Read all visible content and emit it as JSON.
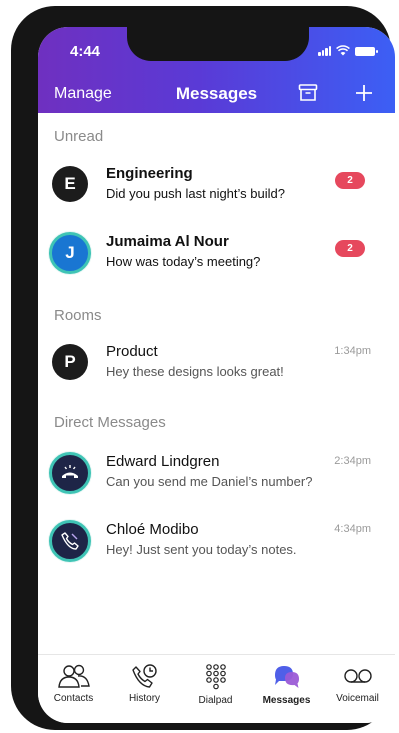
{
  "status_bar": {
    "time": "4:44"
  },
  "header": {
    "left_label": "Manage",
    "title": "Messages"
  },
  "sections": {
    "unread": "Unread",
    "rooms": "Rooms",
    "direct": "Direct Messages"
  },
  "unread": [
    {
      "initial": "E",
      "name": "Engineering",
      "preview": "Did you push last night’s build?",
      "badge": "2"
    },
    {
      "initial": "J",
      "name": "Jumaima Al Nour",
      "preview": "How was today’s meeting?",
      "badge": "2"
    }
  ],
  "rooms": [
    {
      "initial": "P",
      "name": "Product",
      "preview": "Hey these designs looks great!",
      "time": "1:34pm"
    }
  ],
  "direct": [
    {
      "name": "Edward Lindgren",
      "preview": "Can you send me Daniel’s number?",
      "time": "2:34pm"
    },
    {
      "name": "Chloé Modibo",
      "preview": "Hey! Just sent you today’s notes.",
      "time": "4:34pm"
    }
  ],
  "tabs": [
    {
      "label": "Contacts"
    },
    {
      "label": "History"
    },
    {
      "label": "Dialpad"
    },
    {
      "label": "Messages",
      "active": true
    },
    {
      "label": "Voicemail"
    }
  ],
  "colors": {
    "header_start": "#6f30c0",
    "header_end": "#3c5ff5",
    "badge": "#e6485d",
    "ring": "#3fc4b5",
    "active_tab": "#5b4fe0"
  }
}
